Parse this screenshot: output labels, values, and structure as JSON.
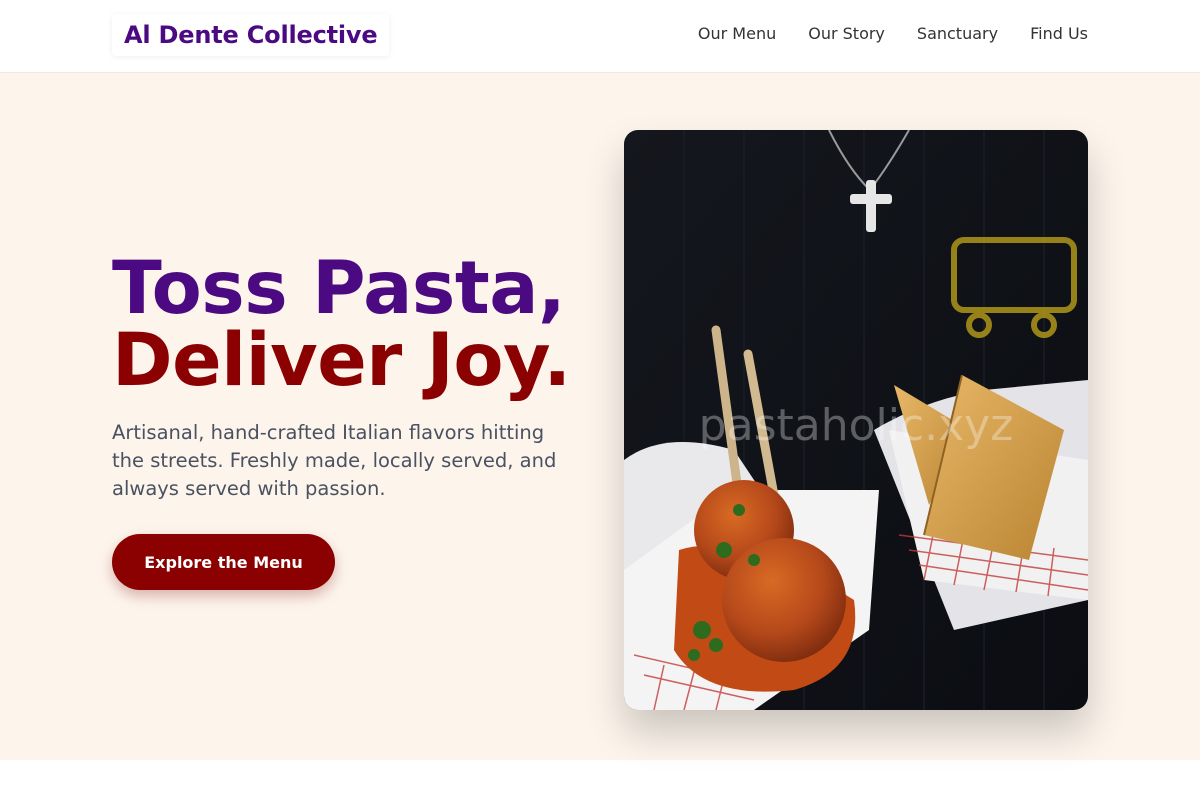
{
  "brand": {
    "name": "Al Dente Collective",
    "primary_color": "#4b0a82",
    "accent_color": "#8b0000",
    "hero_background": "#fdf5ec"
  },
  "nav": {
    "items": [
      {
        "label": "Our Menu"
      },
      {
        "label": "Our Story"
      },
      {
        "label": "Sanctuary"
      },
      {
        "label": "Find Us"
      }
    ]
  },
  "hero": {
    "headline_line1": "Toss Pasta,",
    "headline_line2": "Deliver Joy.",
    "description": "Artisanal, hand-crafted Italian flavors hitting the streets. Freshly made, locally served, and always served with passion.",
    "cta_label": "Explore the Menu",
    "image": {
      "alt": "Gloved hands holding paper trays of meatballs in tomato sauce and fried pastries",
      "watermark": "pastaholic.xyz"
    }
  }
}
